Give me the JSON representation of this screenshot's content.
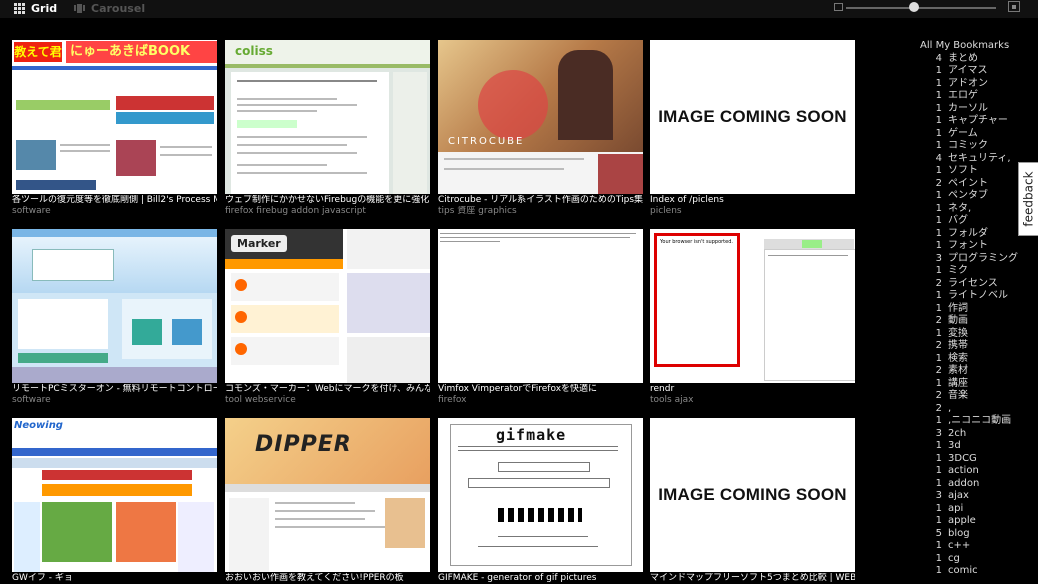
{
  "topbar": {
    "grid_label": "Grid",
    "carousel_label": "Carousel",
    "zoom_level": 0.45
  },
  "items": [
    {
      "title": "各ツールの復元度等を徹底剛側 | Bill2's Process Mar",
      "tags": "software",
      "thumb_text": "にゅーあきばBOOK",
      "logo": "教えて君"
    },
    {
      "title": "ウェブ制作にかかせないFirebugの機能を更に強化す",
      "tags": "firefox firebug addon javascript",
      "thumb_text": "coliss"
    },
    {
      "title": "Citrocube - リアル系イラスト作画のためのTips集",
      "tags": "tips 資座 graphics",
      "thumb_text": "CITROCUBE"
    },
    {
      "title": "Index of /piclens",
      "tags": "piclens",
      "thumb_text": "IMAGE COMING SOON"
    },
    {
      "title": "リモートPCミスターオン - 無料リモートコントロール・遠",
      "tags": "software",
      "thumb_text": ""
    },
    {
      "title": "コモンズ・マーカー：Webにマークを付け、みんなで共",
      "tags": "tool webservice",
      "thumb_text": "Marker"
    },
    {
      "title": "Vimfox VimperatorでFirefoxを快適に",
      "tags": "firefox",
      "thumb_text": ""
    },
    {
      "title": "rendr",
      "tags": "tools ajax",
      "thumb_text": "Your browser isn't supported."
    },
    {
      "title": "GWイフ - ギョ",
      "tags": "",
      "thumb_text": "Neowing"
    },
    {
      "title": "おおいおい作画を教えてください!PPERの板",
      "tags": "",
      "thumb_text": "DIPPER"
    },
    {
      "title": "GIFMAKE - generator of gif pictures",
      "tags": "",
      "thumb_text": "gifmake"
    },
    {
      "title": "マインドマップフリーソフト5つまとめ比較 | WEB",
      "tags": "",
      "thumb_text": "IMAGE COMING SOON"
    }
  ],
  "sidebar": {
    "title": "All My Bookmarks",
    "items": [
      {
        "count": "4",
        "label": "まとめ"
      },
      {
        "count": "1",
        "label": "アイマス"
      },
      {
        "count": "1",
        "label": "アドオン"
      },
      {
        "count": "1",
        "label": "エロゲ"
      },
      {
        "count": "1",
        "label": "カーソル"
      },
      {
        "count": "1",
        "label": "キャプチャー"
      },
      {
        "count": "1",
        "label": "ゲーム"
      },
      {
        "count": "1",
        "label": "コミック"
      },
      {
        "count": "4",
        "label": "セキュリティ,"
      },
      {
        "count": "1",
        "label": "ソフト"
      },
      {
        "count": "2",
        "label": "ペイント"
      },
      {
        "count": "1",
        "label": "ペンタブ"
      },
      {
        "count": "1",
        "label": "ネタ,"
      },
      {
        "count": "1",
        "label": "バグ"
      },
      {
        "count": "1",
        "label": "フォルダ"
      },
      {
        "count": "1",
        "label": "フォント"
      },
      {
        "count": "3",
        "label": "プログラミング"
      },
      {
        "count": "1",
        "label": "ミク"
      },
      {
        "count": "2",
        "label": "ライセンス"
      },
      {
        "count": "1",
        "label": "ライトノベル"
      },
      {
        "count": "1",
        "label": "作詞"
      },
      {
        "count": "2",
        "label": "動画"
      },
      {
        "count": "1",
        "label": "変換"
      },
      {
        "count": "2",
        "label": "携帯"
      },
      {
        "count": "1",
        "label": "検索"
      },
      {
        "count": "2",
        "label": "素材"
      },
      {
        "count": "1",
        "label": "講座"
      },
      {
        "count": "2",
        "label": "音楽"
      },
      {
        "count": "2",
        "label": ","
      },
      {
        "count": "1",
        "label": ",ニコニコ動画"
      },
      {
        "count": "3",
        "label": "2ch"
      },
      {
        "count": "1",
        "label": "3d"
      },
      {
        "count": "1",
        "label": "3DCG"
      },
      {
        "count": "1",
        "label": "action"
      },
      {
        "count": "1",
        "label": "addon"
      },
      {
        "count": "3",
        "label": "ajax"
      },
      {
        "count": "1",
        "label": "api"
      },
      {
        "count": "1",
        "label": "apple"
      },
      {
        "count": "5",
        "label": "blog"
      },
      {
        "count": "1",
        "label": "c++"
      },
      {
        "count": "1",
        "label": "cg"
      },
      {
        "count": "1",
        "label": "comic"
      }
    ]
  },
  "feedback_label": "feedback",
  "colors": {
    "background": "#000000",
    "topbar": "#111111",
    "accent": "#ffffff"
  }
}
